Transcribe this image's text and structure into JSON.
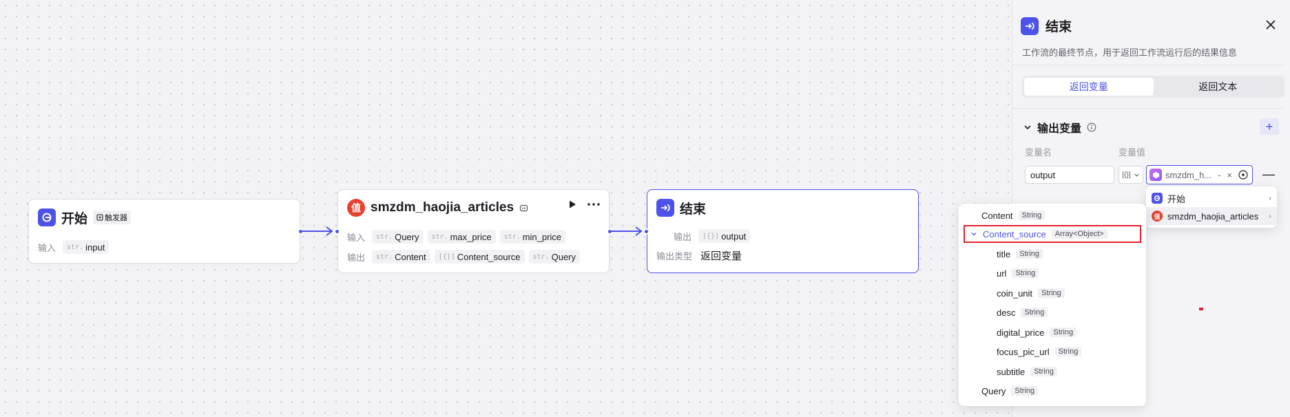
{
  "nodes": {
    "start": {
      "title": "开始",
      "badge": "触发器",
      "input_label": "输入",
      "input_tag": "input",
      "input_type": "str."
    },
    "plugin": {
      "title": "smzdm_haojia_articles",
      "input_label": "输入",
      "output_label": "输出",
      "inputs": [
        {
          "type": "str.",
          "name": "Query"
        },
        {
          "type": "str.",
          "name": "max_price"
        },
        {
          "type": "str.",
          "name": "min_price"
        }
      ],
      "outputs": [
        {
          "type": "str.",
          "name": "Content"
        },
        {
          "type": "[{}]",
          "name": "Content_source"
        },
        {
          "type": "str.",
          "name": "Query"
        }
      ]
    },
    "end": {
      "title": "结束",
      "output_label": "输出",
      "output_type_marker": "[{}]",
      "output_name": "output",
      "output_type_label": "输出类型",
      "output_type_value": "返回变量"
    }
  },
  "panel": {
    "title": "结束",
    "description": "工作流的最终节点，用于返回工作流运行后的结果信息",
    "tabs": [
      "返回变量",
      "返回文本"
    ],
    "active_tab": 0,
    "section_title": "输出变量",
    "col_name": "变量名",
    "col_value": "变量值",
    "var_name_value": "output",
    "type_marker": "[{}]",
    "value_text": "smzdm_h...",
    "value_dash": "-",
    "value_clear": "×"
  },
  "source_menu": [
    {
      "label": "开始",
      "icon": "start-icon"
    },
    {
      "label": "smzdm_haojia_articles",
      "icon": "smzdm-icon"
    }
  ],
  "field_menu": [
    {
      "name": "Content",
      "type": "String",
      "indent": 0
    },
    {
      "name": "Content_source",
      "type": "Array<Object>",
      "indent": 0,
      "selected": true
    },
    {
      "name": "title",
      "type": "String",
      "indent": 1
    },
    {
      "name": "url",
      "type": "String",
      "indent": 1
    },
    {
      "name": "coin_unit",
      "type": "String",
      "indent": 1
    },
    {
      "name": "desc",
      "type": "String",
      "indent": 1
    },
    {
      "name": "digital_price",
      "type": "String",
      "indent": 1
    },
    {
      "name": "focus_pic_url",
      "type": "String",
      "indent": 1
    },
    {
      "name": "subtitle",
      "type": "String",
      "indent": 1
    },
    {
      "name": "Query",
      "type": "String",
      "indent": 0
    }
  ],
  "colors": {
    "accent": "#4d53e8",
    "danger": "#e0202e",
    "plugin_red": "#e8402f"
  }
}
